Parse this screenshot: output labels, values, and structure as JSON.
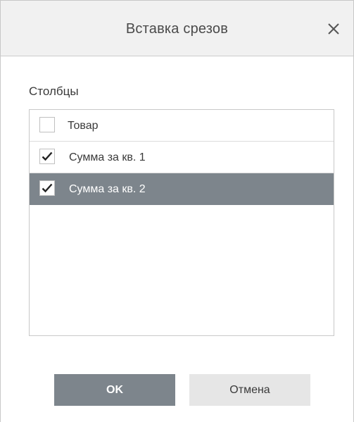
{
  "dialog": {
    "title": "Вставка срезов",
    "close_icon": "close-icon"
  },
  "columns": {
    "label": "Столбцы",
    "items": [
      {
        "label": "Товар",
        "checked": false,
        "selected": false
      },
      {
        "label": "Сумма за кв. 1",
        "checked": true,
        "selected": false
      },
      {
        "label": "Сумма за кв. 2",
        "checked": true,
        "selected": true
      }
    ]
  },
  "buttons": {
    "ok_label": "OK",
    "cancel_label": "Отмена"
  },
  "colors": {
    "header_bg": "#f1f1f1",
    "selected_row": "#7d858c",
    "primary_button": "#7d858c",
    "secondary_button": "#e6e6e6"
  }
}
